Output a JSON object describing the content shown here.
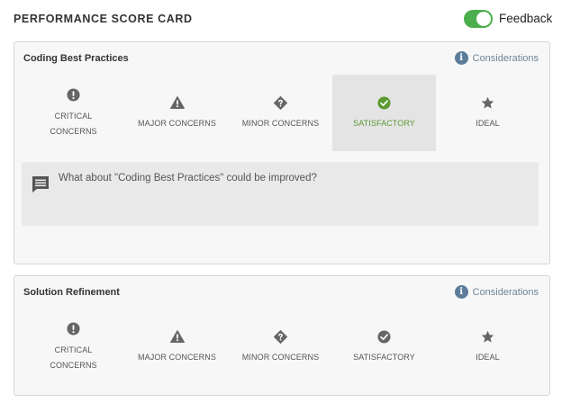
{
  "header": {
    "title": "PERFORMANCE SCORE CARD",
    "feedback_label": "Feedback",
    "feedback_enabled": true
  },
  "colors": {
    "toggle_on": "#4cae4c",
    "selected_green": "#5b9a32",
    "info_blue": "#5b7d9a",
    "icon_gray": "#666666"
  },
  "cards": [
    {
      "title": "Coding Best Practices",
      "considerations_label": "Considerations",
      "ratings": [
        {
          "label": "CRITICAL CONCERNS",
          "icon": "exclamation-circle-icon",
          "selected": false
        },
        {
          "label": "MAJOR CONCERNS",
          "icon": "warning-triangle-icon",
          "selected": false
        },
        {
          "label": "MINOR CONCERNS",
          "icon": "question-diamond-icon",
          "selected": false
        },
        {
          "label": "SATISFACTORY",
          "icon": "check-circle-icon",
          "selected": true
        },
        {
          "label": "IDEAL",
          "icon": "star-icon",
          "selected": false
        }
      ],
      "comment_placeholder": "What about \"Coding Best Practices\" could be improved?"
    },
    {
      "title": "Solution Refinement",
      "considerations_label": "Considerations",
      "ratings": [
        {
          "label": "CRITICAL CONCERNS",
          "icon": "exclamation-circle-icon",
          "selected": false
        },
        {
          "label": "MAJOR CONCERNS",
          "icon": "warning-triangle-icon",
          "selected": false
        },
        {
          "label": "MINOR CONCERNS",
          "icon": "question-diamond-icon",
          "selected": false
        },
        {
          "label": "SATISFACTORY",
          "icon": "check-circle-icon",
          "selected": false
        },
        {
          "label": "IDEAL",
          "icon": "star-icon",
          "selected": false
        }
      ]
    }
  ]
}
